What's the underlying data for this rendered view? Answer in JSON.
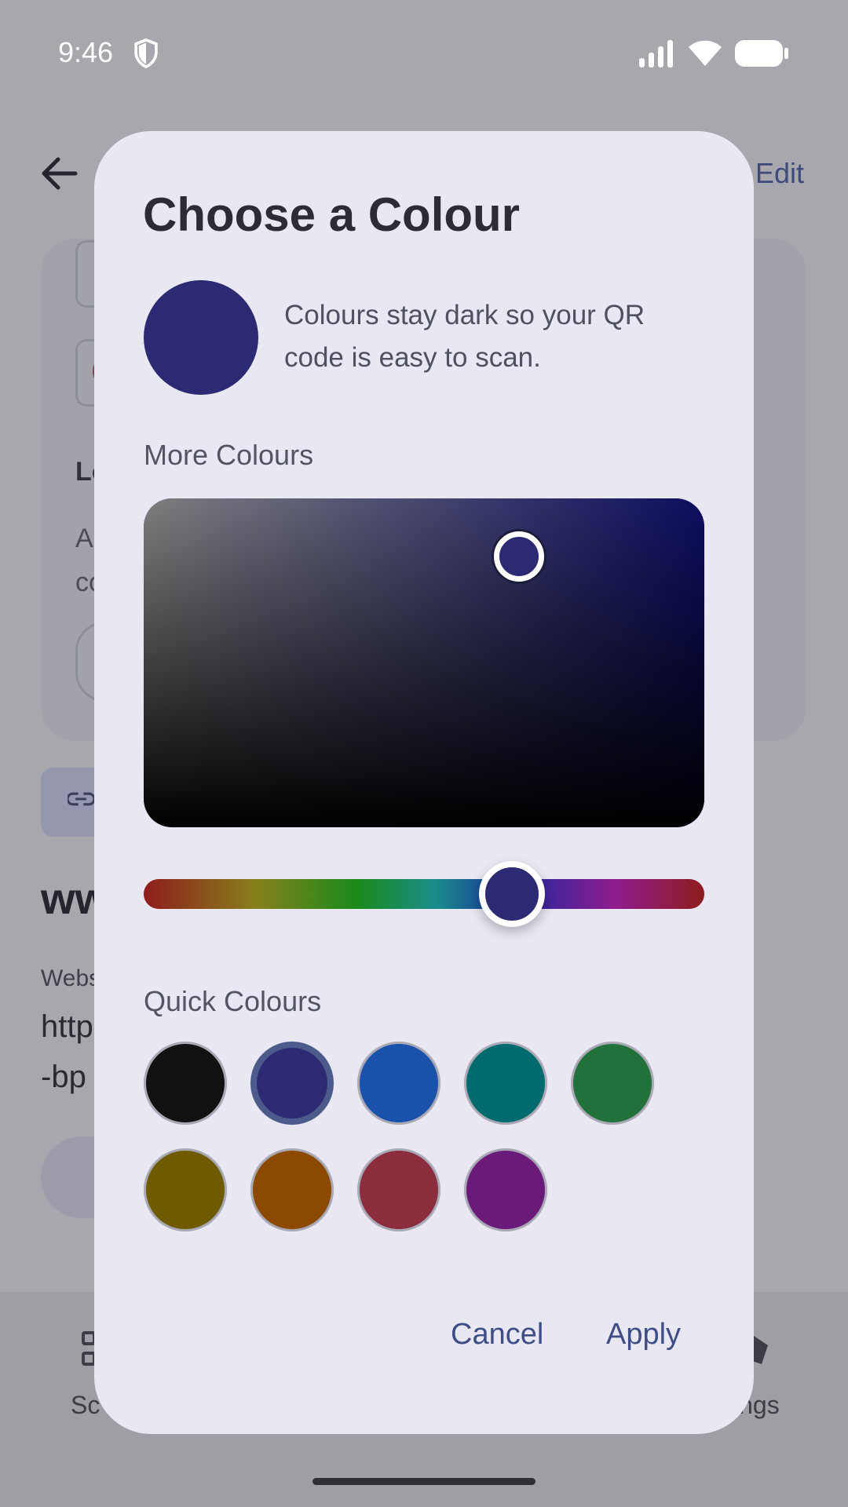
{
  "status_bar": {
    "time": "9:46",
    "icons": [
      "shield-icon",
      "signal-icon",
      "wifi-icon",
      "battery-icon"
    ]
  },
  "background": {
    "edit_label": "Edit",
    "section_label_fragment": "Lo",
    "desc_fragment_1": "A",
    "desc_fragment_2": "co",
    "url_heading_fragment": "ww",
    "website_label_fragment": "Webs",
    "url_fragment_1": "http",
    "url_fragment_2": "-bp",
    "nav_left_fragment": "Sc",
    "nav_right_fragment": "ings"
  },
  "dialog": {
    "title": "Choose a Colour",
    "preview_color": "#2b2a72",
    "description": "Colours stay dark so your QR code is easy to scan.",
    "more_colours_label": "More Colours",
    "hue_color": "#1a1ac0",
    "selected_hue_thumb_color": "#2b2a72",
    "quick_colours_label": "Quick Colours",
    "quick_colours": [
      {
        "name": "black",
        "hex": "#121212",
        "selected": false
      },
      {
        "name": "indigo",
        "hex": "#2b2a72",
        "selected": true
      },
      {
        "name": "blue",
        "hex": "#1a52ab",
        "selected": false
      },
      {
        "name": "teal",
        "hex": "#006a6e",
        "selected": false
      },
      {
        "name": "green",
        "hex": "#22703a",
        "selected": false
      },
      {
        "name": "olive",
        "hex": "#6e5b00",
        "selected": false
      },
      {
        "name": "orange",
        "hex": "#8c4a00",
        "selected": false
      },
      {
        "name": "crimson",
        "hex": "#8c2d3d",
        "selected": false
      },
      {
        "name": "purple",
        "hex": "#6a1a78",
        "selected": false
      }
    ],
    "cancel_label": "Cancel",
    "apply_label": "Apply"
  }
}
